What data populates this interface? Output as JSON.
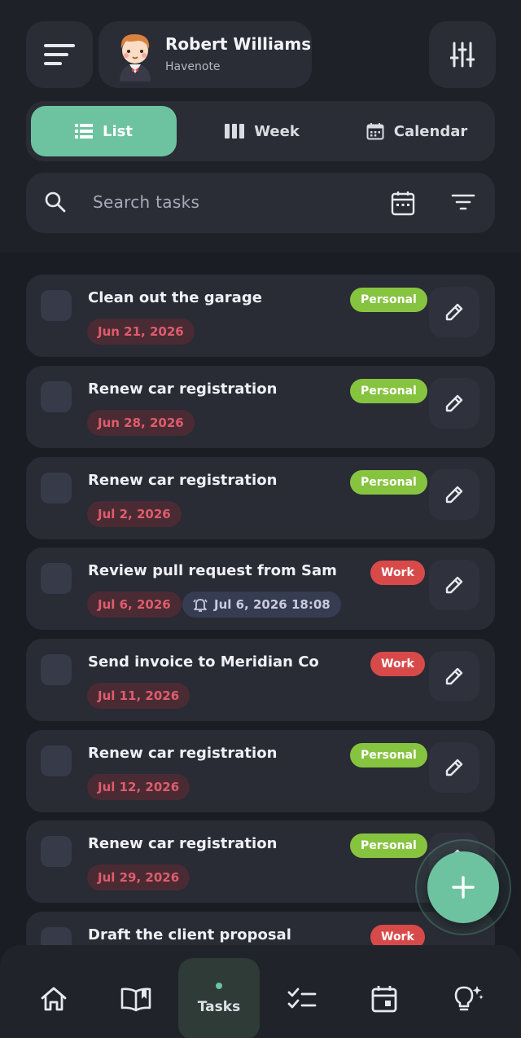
{
  "header": {
    "user_name": "Robert Williams",
    "app_name": "Havenote",
    "menu_icon": "menu-icon",
    "settings_icon": "sliders-icon"
  },
  "view_tabs": [
    {
      "label": "List",
      "icon": "list-icon",
      "active": true
    },
    {
      "label": "Week",
      "icon": "columns-icon",
      "active": false
    },
    {
      "label": "Calendar",
      "icon": "calendar-icon",
      "active": false
    }
  ],
  "search": {
    "placeholder": "Search tasks"
  },
  "tasks": [
    {
      "title": "Clean out the garage",
      "tag": "Personal",
      "date": "Jun 21, 2026"
    },
    {
      "title": "Renew car registration",
      "tag": "Personal",
      "date": "Jun 28, 2026"
    },
    {
      "title": "Renew car registration",
      "tag": "Personal",
      "date": "Jul 2, 2026"
    },
    {
      "title": "Review pull request from Sam",
      "tag": "Work",
      "date": "Jul 6, 2026",
      "reminder": "Jul 6, 2026 18:08"
    },
    {
      "title": "Send invoice to Meridian Co",
      "tag": "Work",
      "date": "Jul 11, 2026"
    },
    {
      "title": "Renew car registration",
      "tag": "Personal",
      "date": "Jul 12, 2026"
    },
    {
      "title": "Renew car registration",
      "tag": "Personal",
      "date": "Jul 29, 2026"
    },
    {
      "title": "Draft the client proposal",
      "tag": "Work"
    }
  ],
  "bottom_nav": [
    {
      "icon": "home-icon"
    },
    {
      "icon": "book-icon"
    },
    {
      "label": "Tasks",
      "icon": "dot-indicator",
      "active": true
    },
    {
      "icon": "checklist-icon"
    },
    {
      "icon": "calendar-icon"
    },
    {
      "icon": "lightbulb-icon"
    }
  ],
  "colors": {
    "accent": "#6dc3a0",
    "personal_tag": "#86c440",
    "work_tag": "#d84a4a",
    "due_date_text": "#e05c6d",
    "background": "#1b1d25",
    "card": "#292b35"
  }
}
